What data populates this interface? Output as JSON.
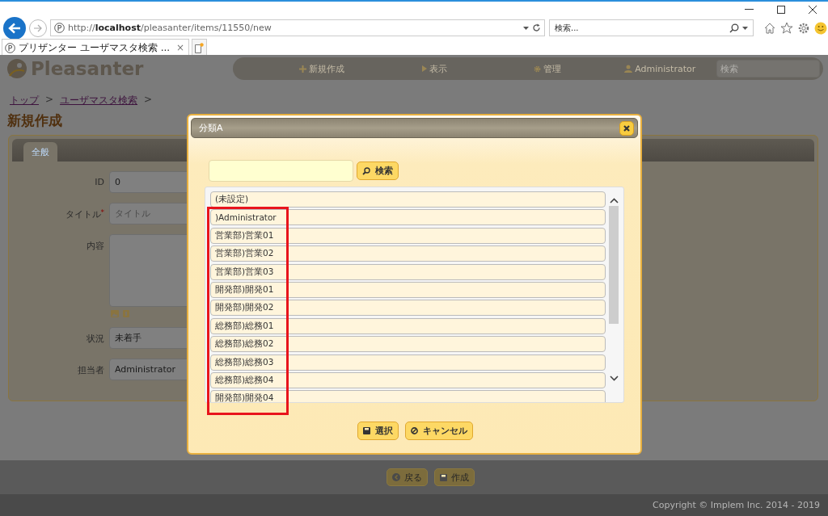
{
  "browser": {
    "url": "http://**localhost**/pleasanter/items/11550/new",
    "search_placeholder": "検索...",
    "tabs": [
      {
        "title": "プリザンター ユーザマスタ検索 ...",
        "close": "×",
        "selected": true
      }
    ]
  },
  "app": {
    "logo": "Pleasanter",
    "nav": [
      {
        "label": "新規作成"
      },
      {
        "label": "表示"
      },
      {
        "label": "管理"
      },
      {
        "label": "Administrator"
      }
    ],
    "nav_search_placeholder": "検索",
    "breadcrumb": [
      {
        "label": "トップ",
        "separator": ">"
      },
      {
        "label": "ユーザマスタ検索",
        "separator": ">"
      }
    ],
    "title": "新規作成",
    "tabs": [
      {
        "label": "全般",
        "selected": true
      }
    ],
    "fields": [
      {
        "label": "ID",
        "kind": "text",
        "value": "0"
      },
      {
        "label": "タイトル",
        "kind": "text",
        "required_mark": "*",
        "placeholder": "タイトル"
      },
      {
        "label": "内容",
        "kind": "textarea"
      },
      {
        "label": "状況",
        "kind": "text",
        "value": "未着手"
      },
      {
        "label": "担当者",
        "kind": "text",
        "value": "Administrator"
      }
    ],
    "buttons": [
      {
        "label": "戻る"
      },
      {
        "label": "作成"
      }
    ],
    "copyright": "Copyright © Implem Inc. 2014 - 2019"
  },
  "dialog": {
    "title": "分類A",
    "search_button": "検索",
    "options": [
      {
        "label": "(未設定)"
      },
      {
        "label": ")Administrator"
      },
      {
        "label": "営業部)営業01"
      },
      {
        "label": "営業部)営業02"
      },
      {
        "label": "営業部)営業03"
      },
      {
        "label": "開発部)開発01"
      },
      {
        "label": "開発部)開発02"
      },
      {
        "label": "総務部)総務01"
      },
      {
        "label": "総務部)総務02"
      },
      {
        "label": "総務部)総務03"
      },
      {
        "label": "総務部)総務04"
      },
      {
        "label": "開発部)開発04"
      }
    ],
    "buttons": [
      {
        "label": "選択"
      },
      {
        "label": "キャンセル"
      }
    ]
  }
}
